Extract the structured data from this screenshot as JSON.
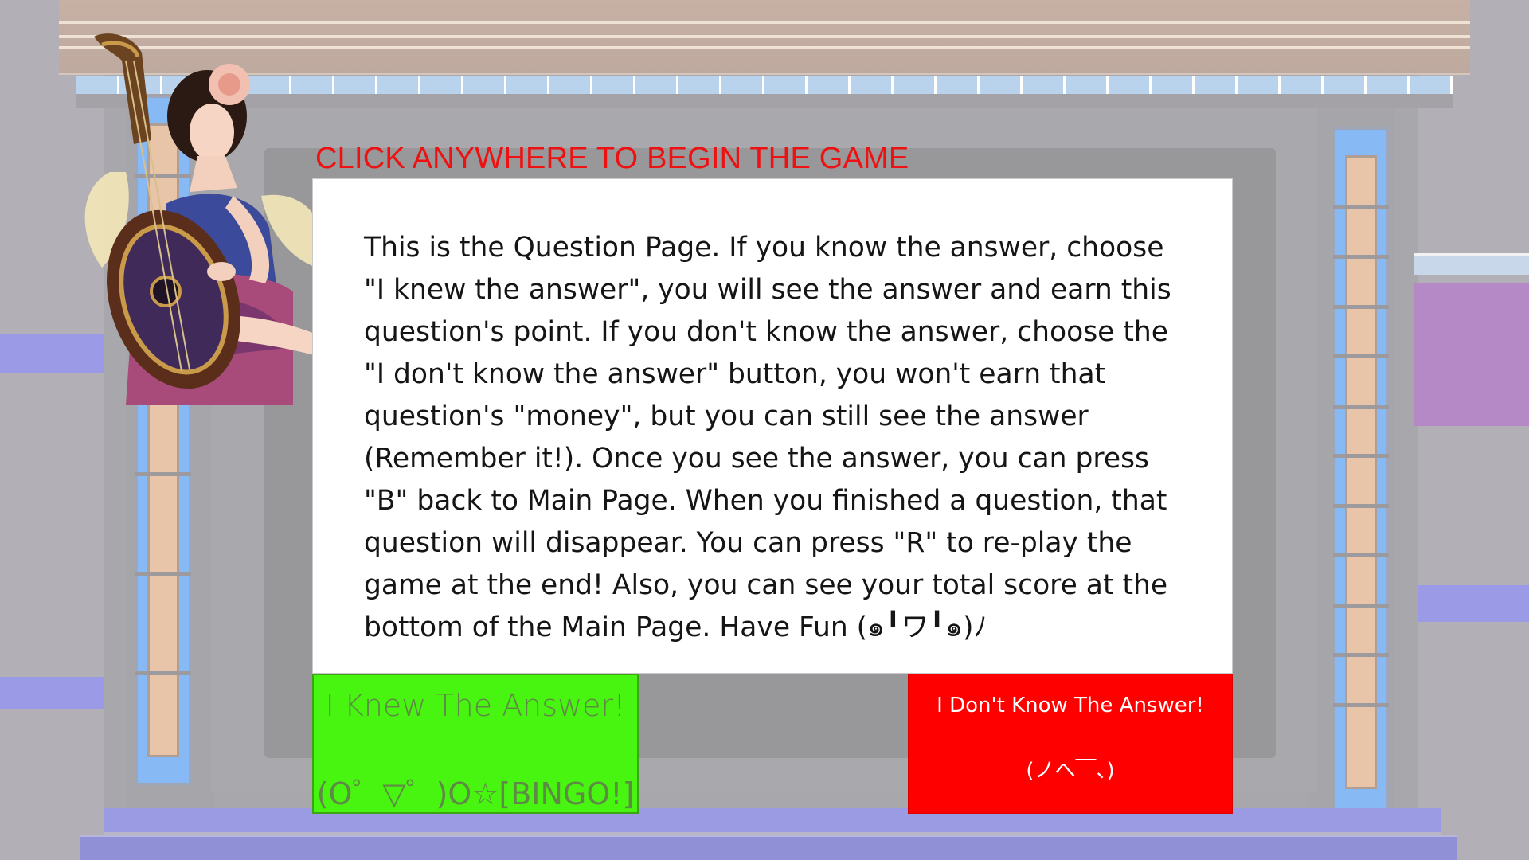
{
  "screen": {
    "prompt": "CLICK ANYWHERE TO BEGIN THE GAME",
    "instructions": "This is the Question Page. If you know the answer, choose \"I knew the answer\", you will see the answer and earn this question's point. If you don't know the answer, choose the \"I don't know the answer\" button, you won't earn that question's \"money\", but you can still see the answer (Remember it!). Once you see the answer, you can press \"B\" back to Main Page. When you finished a question, that question will disappear. You can press \"R\" to re-play the game at the end! Also, you can see your total score at the bottom of the Main Page. Have Fun (๑╹ワ╹๑)ﾉ"
  },
  "buttons": {
    "knew": {
      "label": "I Knew The Answer!",
      "emoticon": "(O゜▽゜)O☆[BINGO!]"
    },
    "dont_know": {
      "label": "I Don't Know The Answer!",
      "emoticon": "(ノへ￣、)"
    }
  },
  "colors": {
    "prompt": "#ee1111",
    "knew_button": "#48f510",
    "dont_know_button": "#ff0000",
    "stage_purple": "#9a9ae6"
  },
  "icons": {
    "character": "lute-goddess-illustration"
  }
}
